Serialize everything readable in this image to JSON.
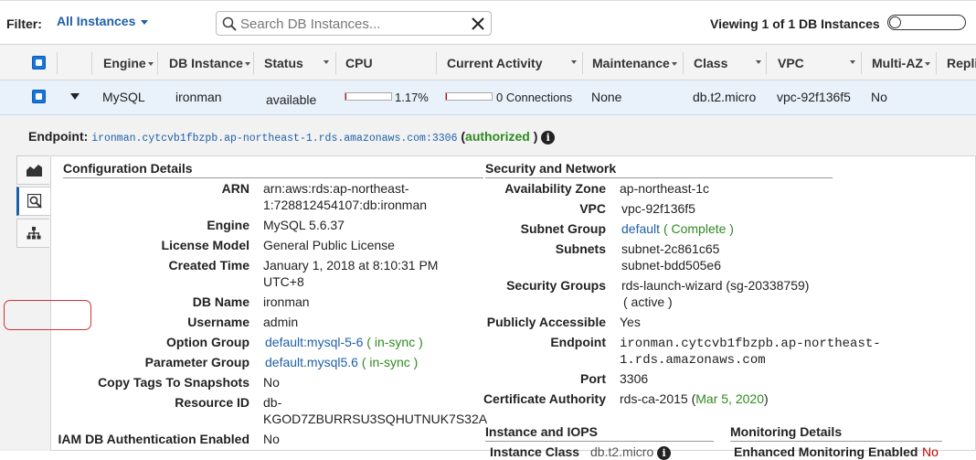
{
  "filter": {
    "label": "Filter:",
    "selected": "All Instances",
    "search_placeholder": "Search DB Instances...",
    "viewing": "Viewing 1 of 1 DB Instances"
  },
  "columns": [
    "Engine",
    "DB Instance",
    "Status",
    "CPU",
    "Current Activity",
    "Maintenance",
    "Class",
    "VPC",
    "Multi-AZ",
    "Repli"
  ],
  "row": {
    "engine": "MySQL",
    "db_instance": "ironman",
    "status": "available",
    "cpu": "1.17%",
    "cpu_fraction": 0.0117,
    "current_activity": "0 Connections",
    "activity_fraction": 0.0,
    "maintenance": "None",
    "class": "db.t2.micro",
    "vpc": "vpc-92f136f5",
    "multi_az": "No"
  },
  "endpoint": {
    "label": "Endpoint:",
    "value": "ironman.cytcvb1fbzpb.ap-northeast-1.rds.amazonaws.com:3306",
    "open_paren": "(",
    "status": "authorized",
    "close_paren": ")"
  },
  "config": {
    "title": "Configuration Details",
    "arn_label": "ARN",
    "arn_line1": "arn:aws:rds:ap-northeast-",
    "arn_line2": "1:728812454107:db:ironman",
    "engine_label": "Engine",
    "engine": "MySQL 5.6.37",
    "license_label": "License Model",
    "license": "General Public License",
    "created_label": "Created Time",
    "created_line1": "January 1, 2018 at 8:10:31 PM",
    "created_line2": "UTC+8",
    "dbname_label": "DB Name",
    "dbname": "ironman",
    "username_label": "Username",
    "username": "admin",
    "optgroup_label": "Option Group",
    "optgroup": "default:mysql-5-6",
    "optgroup_status": "in-sync",
    "paramgroup_label": "Parameter Group",
    "paramgroup": "default.mysql5.6",
    "paramgroup_status": "in-sync",
    "copytags_label": "Copy Tags To Snapshots",
    "copytags": "No",
    "resid_label": "Resource ID",
    "resid_line1": "db-",
    "resid_line2": "KGOD7ZBURRSU3SQHUTNUK7S32A",
    "iam_label": "IAM DB Authentication Enabled",
    "iam": "No"
  },
  "security": {
    "title": "Security and Network",
    "az_label": "Availability Zone",
    "az": "ap-northeast-1c",
    "vpc_label": "VPC",
    "vpc": "vpc-92f136f5",
    "subnetgroup_label": "Subnet Group",
    "subnetgroup": "default",
    "subnetgroup_status": "Complete",
    "subnets_label": "Subnets",
    "subnet1": "subnet-2c861c65",
    "subnet2": "subnet-bdd505e6",
    "secgroups_label": "Security Groups",
    "secgroup": "rds-launch-wizard (sg-20338759)",
    "secgroup_status": "( active )",
    "public_label": "Publicly Accessible",
    "public": "Yes",
    "endpoint_label": "Endpoint",
    "endpoint_line1": "ironman.cytcvb1fbzpb.ap-northeast-",
    "endpoint_line2": "1.rds.amazonaws.com",
    "port_label": "Port",
    "port": "3306",
    "ca_label": "Certificate Authority",
    "ca": "rds-ca-2015",
    "ca_date": "Mar 5, 2020"
  },
  "instance": {
    "title": "Instance and IOPS",
    "class_label": "Instance Class",
    "class": "db.t2.micro"
  },
  "monitoring": {
    "title": "Monitoring Details",
    "enhanced_label": "Enhanced Monitoring Enabled",
    "enhanced": "No"
  }
}
